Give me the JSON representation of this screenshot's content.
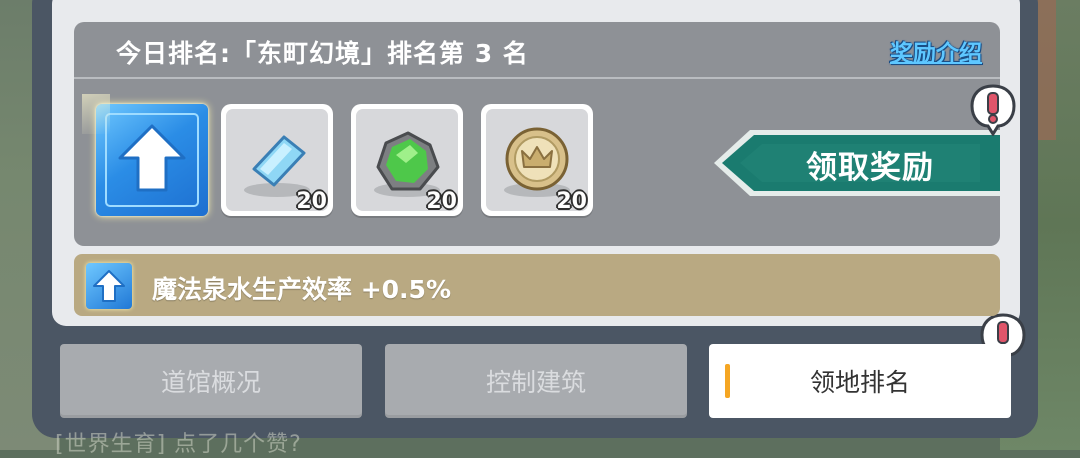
{
  "background": {
    "bottom_text": "[世界生育] 点了几个赞?"
  },
  "ranking": {
    "title": "今日排名:「东町幻境」排名第 3 名",
    "reward_intro_link": "奖励介绍"
  },
  "rewards": {
    "buff_icon": "up-arrow-icon",
    "items": [
      {
        "icon": "ice-crystal-icon",
        "count": "20"
      },
      {
        "icon": "green-ore-icon",
        "count": "20"
      },
      {
        "icon": "crown-coin-icon",
        "count": "20"
      }
    ],
    "claim_button": "领取奖励"
  },
  "buff": {
    "icon": "up-arrow-icon",
    "text": "魔法泉水生产效率 +0.5%"
  },
  "tabs": [
    {
      "label": "道馆概况",
      "active": false
    },
    {
      "label": "控制建筑",
      "active": false
    },
    {
      "label": "领地排名",
      "active": true
    }
  ],
  "colors": {
    "panel": "#4b5664",
    "rank_box": "#8e9196",
    "claim_button": "#1a7b6f",
    "buff_bar": "#b9a982",
    "link": "#5ec7ff",
    "tab_marker": "#f5a623",
    "alert": "#e0556a"
  }
}
